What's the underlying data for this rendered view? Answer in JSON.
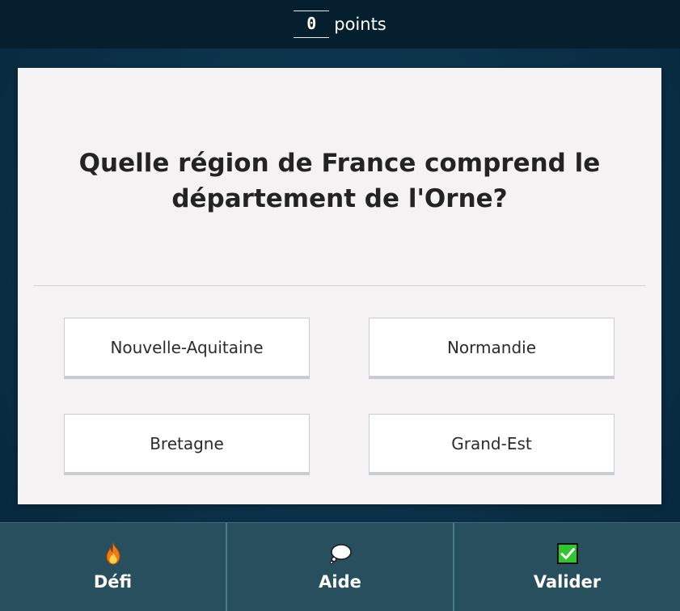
{
  "header": {
    "score_value": "0",
    "score_label": "points"
  },
  "quiz": {
    "question": "Quelle région de France comprend le département de l'Orne?",
    "answers": [
      {
        "label": "Nouvelle-Aquitaine"
      },
      {
        "label": "Normandie"
      },
      {
        "label": "Bretagne"
      },
      {
        "label": "Grand-Est"
      }
    ]
  },
  "actions": [
    {
      "label": "Défi",
      "icon": "fire-icon"
    },
    {
      "label": "Aide",
      "icon": "speech-bubble-icon"
    },
    {
      "label": "Valider",
      "icon": "check-box-icon"
    }
  ],
  "colors": {
    "background": "#0a3047",
    "topbar": "#061f2e",
    "card": "#f4f2f3",
    "bottombar": "#284f5e",
    "check_green": "#2ec52e"
  }
}
